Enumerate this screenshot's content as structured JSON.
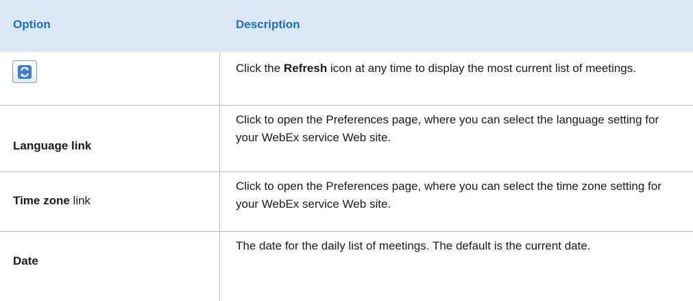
{
  "table": {
    "header": {
      "option": "Option",
      "description": "Description"
    },
    "rows": [
      {
        "option_icon": "refresh-icon",
        "desc_pre": "Click the ",
        "desc_bold": "Refresh",
        "desc_post": " icon at any time to display the most current list of meetings."
      },
      {
        "option_bold": "Language link",
        "description": "Click to open the Preferences page, where you can select the language setting for your WebEx service Web site."
      },
      {
        "option_bold": "Time zone",
        "option_rest": " link",
        "description": "Click to open the Preferences page, where you can select the time zone setting for your WebEx service Web site."
      },
      {
        "option_bold": "Date",
        "description": "The date for the daily list of meetings. The default is the current date."
      }
    ]
  },
  "colors": {
    "header_bg": "#dbe8f4",
    "header_text": "#1b6ec2",
    "rule": "#b8b8b8"
  }
}
